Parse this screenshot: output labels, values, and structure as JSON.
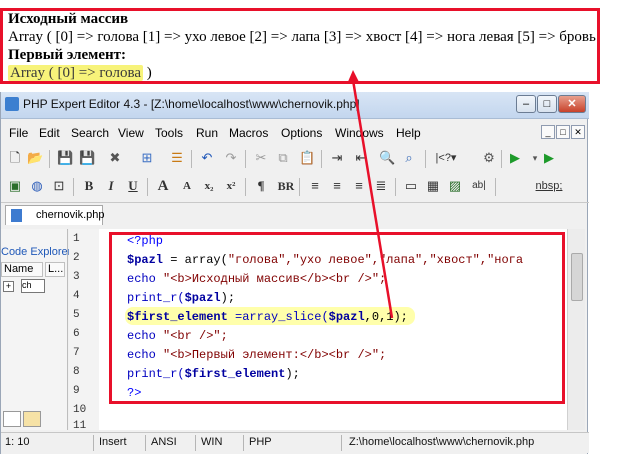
{
  "output": {
    "heading1": "Исходный массив",
    "array_line": "Array ( [0] => голова [1] => ухо левое [2] => лапа [3] => хвост [4] => нога левая [5] => бровь",
    "heading2": "Первый элемент:",
    "result_text": "Array ( [0] => голова",
    "result_close": " )"
  },
  "window": {
    "title": "PHP Expert Editor 4.3 - [Z:\\home\\localhost\\www\\chernovik.php]",
    "minimize_label": "–",
    "maximize_label": "□",
    "close_label": "✕"
  },
  "menu": [
    "File",
    "Edit",
    "Search",
    "View",
    "Tools",
    "Run",
    "Macros",
    "Options",
    "Windows",
    "Help"
  ],
  "mdi_buttons": [
    "_",
    "□",
    "✕"
  ],
  "toolbar2": {
    "bold": "B",
    "italic": "I",
    "underline": "U",
    "font_up": "A",
    "font_down": "A",
    "subscript": "x₂",
    "superscript": "x²",
    "paragraph": "¶",
    "br": "BR",
    "nbsp": "nbsp;"
  },
  "tab": {
    "label": "chernovik.php"
  },
  "left_panel": {
    "title": "Code Explorer",
    "col_name": "Name",
    "col_line": "L...",
    "file_node": "ch"
  },
  "line_numbers": [
    "1",
    "2",
    "3",
    "4",
    "5",
    "6",
    "7",
    "8",
    "9",
    "10",
    "11"
  ],
  "code": {
    "l1": "<?php",
    "l2_var": "$pazl",
    "l2_rest": " = array(",
    "l2_str": "\"голова\",\"ухо левое\",\"лапа\",\"хвост\",\"нога",
    "l3_kw": "echo",
    "l3_str": " \"<b>Исходный массив</b><br />\";",
    "l4_fn": "print_r(",
    "l4_var": "$pazl",
    "l4_end": ");",
    "l5_var": "$first_element",
    "l5_rest": " =array_slice(",
    "l5_var2": "$pazl",
    "l5_end": ",0,1);",
    "l6_kw": "echo",
    "l6_str": " \"<br />\";",
    "l7_kw": "echo",
    "l7_str": " \"<b>Первый элемент:</b><br />\";",
    "l8_fn": "print_r(",
    "l8_var": "$first_element",
    "l8_end": ");",
    "l9": "?>"
  },
  "status": {
    "position": "1: 10",
    "mode": "Insert",
    "encoding": "ANSI",
    "os": "WIN",
    "lang": "PHP",
    "path": "Z:\\home\\localhost\\www\\chernovik.php"
  },
  "colors": {
    "annotation_red": "#e8102a",
    "highlight_yellow": "#f7f37a"
  }
}
